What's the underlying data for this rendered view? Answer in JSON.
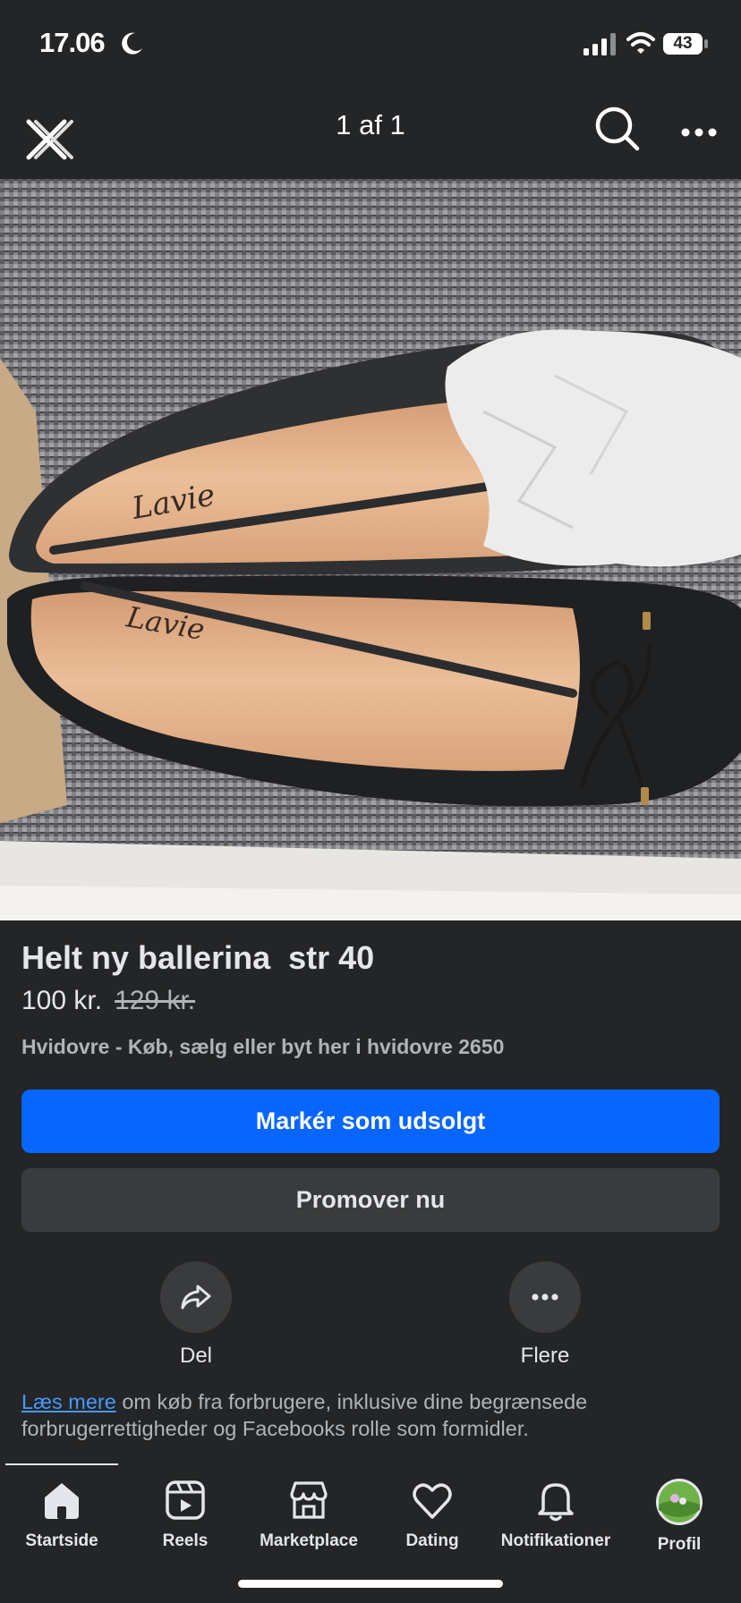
{
  "status_bar": {
    "time": "17.06",
    "battery": "43"
  },
  "top_nav": {
    "title": "1 af 1",
    "icons": [
      "close-icon",
      "search-icon",
      "more-icon"
    ]
  },
  "listing": {
    "title": "Helt ny ballerina  str 40",
    "price": "100 kr.",
    "old_price": "129 kr.",
    "location": "Hvidovre - Køb, sælg eller byt her i hvidovre 2650",
    "insole_brand": "Lavie"
  },
  "buttons": {
    "mark_sold": "Markér som udsolgt",
    "promote": "Promover nu"
  },
  "actions": [
    {
      "label": "Del",
      "icon": "share-icon"
    },
    {
      "label": "Flere",
      "icon": "more-icon"
    }
  ],
  "disclaimer": {
    "link": "Læs mere",
    "text": " om køb fra forbrugere, inklusive dine begrænsede forbrugerrettigheder og Facebooks rolle som formidler."
  },
  "tabs": [
    {
      "label": "Startside",
      "icon": "home-icon",
      "active": true
    },
    {
      "label": "Reels",
      "icon": "reels-icon"
    },
    {
      "label": "Marketplace",
      "icon": "marketplace-icon"
    },
    {
      "label": "Dating",
      "icon": "dating-icon"
    },
    {
      "label": "Notifikationer",
      "icon": "bell-icon"
    },
    {
      "label": "Profil",
      "icon": "avatar"
    }
  ],
  "colors": {
    "background": "#242526",
    "primary": "#0866ff",
    "secondary": "#3a3b3c",
    "link": "#4599ff"
  }
}
